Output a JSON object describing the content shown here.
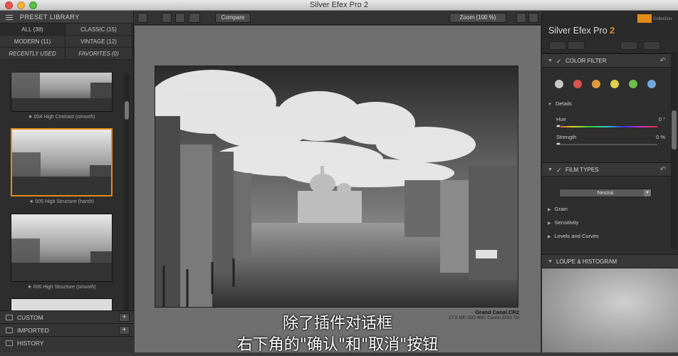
{
  "window": {
    "title": "Silver Efex Pro 2"
  },
  "library": {
    "header": "PRESET LIBRARY",
    "categories": [
      {
        "label": "ALL (38)"
      },
      {
        "label": "CLASSIC (15)"
      },
      {
        "label": "MODERN (11)"
      },
      {
        "label": "VINTAGE (12)"
      },
      {
        "label": "RECENTLY USED"
      },
      {
        "label": "FAVORITES (0)"
      }
    ],
    "presets": [
      {
        "label": "★ 004 High Contrast (smooth)"
      },
      {
        "label": "★ 005 High Structure (harsh)"
      },
      {
        "label": "★ 006 High Structure (smooth)"
      }
    ],
    "sections": [
      {
        "label": "CUSTOM"
      },
      {
        "label": "IMPORTED"
      },
      {
        "label": "HISTORY"
      }
    ]
  },
  "toolbar": {
    "compare_label": "Compare",
    "zoom_label": "Zoom (100 %)"
  },
  "photo": {
    "filename": "Grand Canal.CR2",
    "meta": "17.9 MP, ISO 400, Canon EOS 7D"
  },
  "subtitle": {
    "line1": "除了插件对话框",
    "line2": "右下角的\"确认\"和\"取消\"按钮"
  },
  "right_panel": {
    "brand": "Silver Efex Pro",
    "brand_version": "2",
    "nik_label": "Collection",
    "color_filter": {
      "title": "COLOR FILTER",
      "filters": [
        {
          "color": "#c8c8c8"
        },
        {
          "color": "#d9534f"
        },
        {
          "color": "#e39a3c"
        },
        {
          "color": "#e0d04a"
        },
        {
          "color": "#6cbf4f"
        },
        {
          "color": "#6fa8dc"
        }
      ],
      "details_label": "Details",
      "hue_label": "Hue",
      "hue_value": "0 °",
      "strength_label": "Strength",
      "strength_value": "0 %"
    },
    "film_types": {
      "title": "FILM TYPES",
      "selected": "Neutral",
      "subsections": [
        {
          "label": "Grain"
        },
        {
          "label": "Sensitivity"
        },
        {
          "label": "Levels and Curves"
        }
      ]
    },
    "loupe_title": "LOUPE & HISTOGRAM"
  }
}
